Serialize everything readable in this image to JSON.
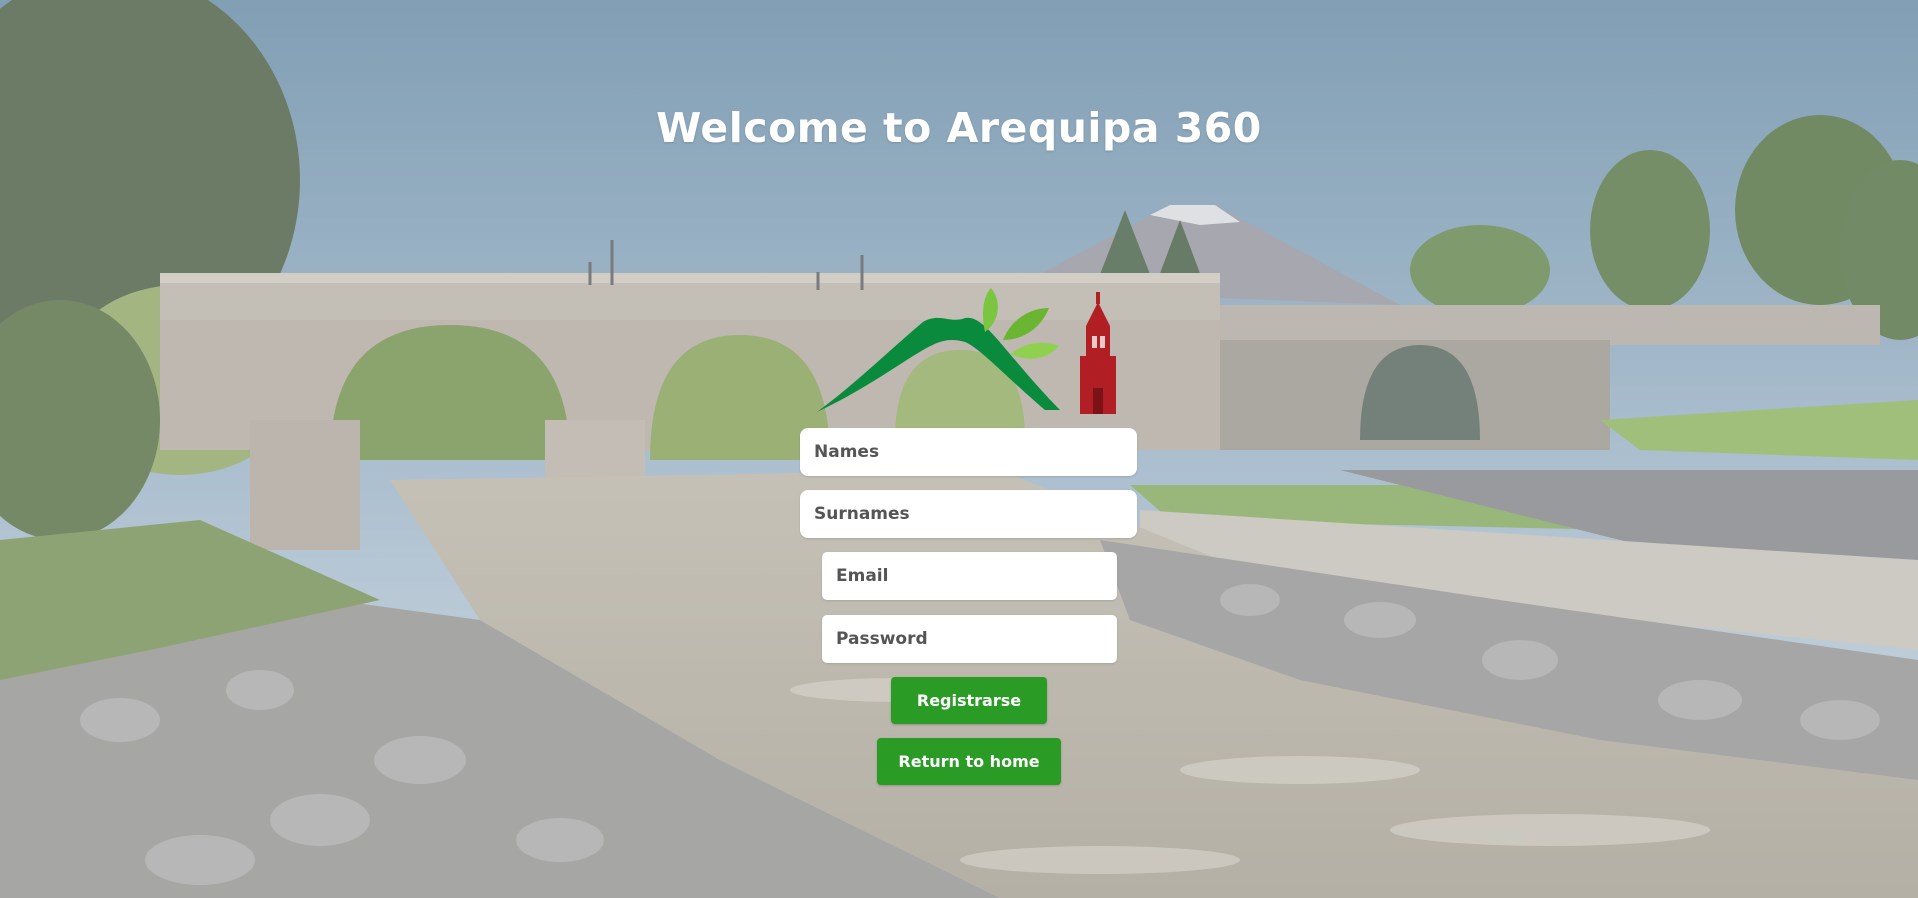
{
  "page": {
    "title": "Welcome to Arequipa 360"
  },
  "form": {
    "names_placeholder": "Names",
    "surnames_placeholder": "Surnames",
    "email_placeholder": "Email",
    "password_placeholder": "Password",
    "register_label": "Registrarse",
    "home_label": "Return to home"
  },
  "colors": {
    "button": "#2a9c25",
    "logo_green": "#0a8a3c",
    "logo_leaf": "#7cc540",
    "logo_church": "#b11f24"
  },
  "icons": [
    "mountain-icon",
    "leaf-icon",
    "church-tower-icon"
  ]
}
